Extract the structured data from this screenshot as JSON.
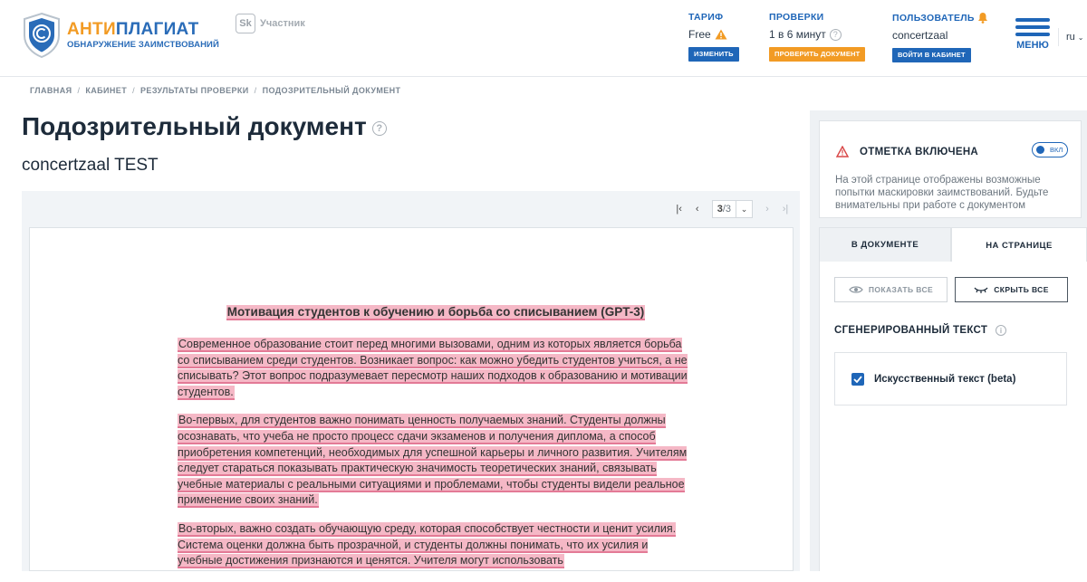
{
  "brand": {
    "title_part1": "АНТИ",
    "title_part2": "ПЛАГИАТ",
    "subtitle": "ОБНАРУЖЕНИЕ ЗАИМСТВОВАНИЙ",
    "sk_mark": "Sk",
    "sk_label": "Участник",
    "primary_color": "#1f66b8",
    "accent_color": "#f29b24"
  },
  "header": {
    "tariff": {
      "caption": "ТАРИФ",
      "value": "Free",
      "button": "ИЗМЕНИТЬ"
    },
    "checks": {
      "caption": "ПРОВЕРКИ",
      "value": "1 в 6 минут",
      "button": "ПРОВЕРИТЬ ДОКУМЕНТ"
    },
    "user": {
      "caption": "ПОЛЬЗОВАТЕЛЬ",
      "value": "concertzaal",
      "button": "ВОЙТИ В КАБИНЕТ"
    },
    "menu_label": "МЕНЮ",
    "lang": "ru"
  },
  "breadcrumb": [
    "ГЛАВНАЯ",
    "КАБИНЕТ",
    "РЕЗУЛЬТАТЫ ПРОВЕРКИ",
    "ПОДОЗРИТЕЛЬНЫЙ ДОКУМЕНТ"
  ],
  "page": {
    "title": "Подозрительный документ",
    "doc_name": "concertzaal TEST"
  },
  "pager": {
    "current": "3",
    "total": "/3"
  },
  "document": {
    "heading": "Мотивация студентов к обучению и борьба со списыванием (GPT-3)",
    "paragraphs": [
      "Современное образование стоит перед многими вызовами, одним из которых является борьба со списыванием среди студентов. Возникает вопрос: как можно убедить студентов учиться, а не списывать? Этот вопрос подразумевает пересмотр наших подходов к образованию и мотивации студентов.",
      "Во-первых, для студентов важно понимать ценность получаемых знаний. Студенты должны осознавать, что учеба не просто процесс сдачи экзаменов и получения диплома, а способ приобретения компетенций, необходимых для успешной карьеры и личного развития. Учителям следует стараться показывать практическую значимость теоретических знаний, связывать учебные материалы с реальными ситуациями и проблемами, чтобы студенты видели реальное применение своих знаний.",
      "Во-вторых, важно создать обучающую среду, которая способствует честности и ценит усилия. Система оценки должна быть прозрачной, и студенты должны понимать, что их усилия и учебные достижения признаются и ценятся. Учителя могут использовать"
    ],
    "highlight_color": "#f5b8c6"
  },
  "sidebar": {
    "notice_title": "ОТМЕТКА ВКЛЮЧЕНА",
    "toggle_label": "ВКЛ",
    "notice_text": "На этой странице отображены возможные попытки маскировки заимствований. Будьте внимательны при работе с документом",
    "tabs": [
      "В ДОКУМЕНТЕ",
      "НА СТРАНИЦЕ"
    ],
    "show_all": "ПОКАЗАТЬ ВСЕ",
    "hide_all": "СКРЫТЬ ВСЕ",
    "generated_heading": "СГЕНЕРИРОВАННЫЙ ТЕКСТ",
    "ai_text_label": "Искусственный текст (beta)"
  }
}
